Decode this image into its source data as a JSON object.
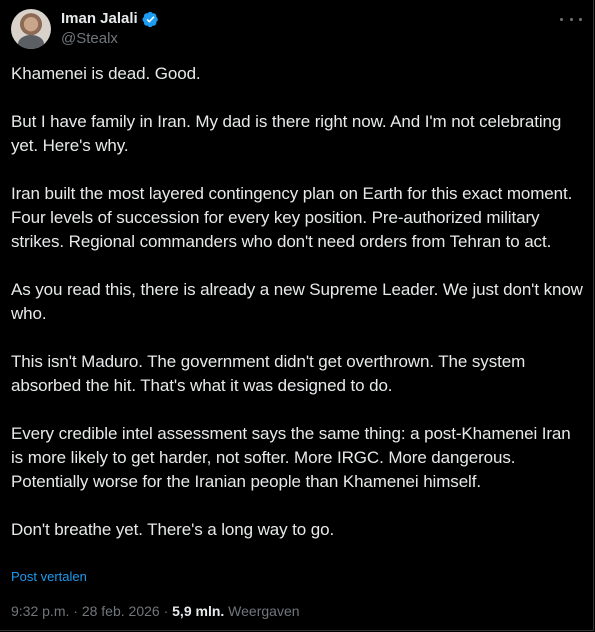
{
  "author": {
    "display_name": "Iman Jalali",
    "handle": "@Stealx",
    "verified": true,
    "verified_color": "#1d9bf0"
  },
  "tweet": {
    "paragraphs": [
      "Khamenei is dead. Good.",
      "But I have family in Iran. My dad is there right now. And I'm not celebrating yet. Here's why.",
      "Iran built the most layered contingency plan on Earth for this exact moment. Four levels of succession for every key position. Pre-authorized military strikes. Regional commanders who don't need orders from Tehran to act.",
      "As you read this, there is already a new Supreme Leader. We just don't know who.",
      "This isn't Maduro. The government didn't get overthrown. The system absorbed the hit. That's what it was designed to do.",
      "Every credible intel assessment says the same thing: a post-Khamenei Iran is more likely to get harder, not softer. More IRGC. More dangerous. Potentially worse for the Iranian people than Khamenei himself.",
      "Don't breathe yet. There's a long way to go."
    ],
    "translate_label": "Post vertalen"
  },
  "meta": {
    "time": "9:32 p.m.",
    "separator": " · ",
    "date": "28 feb. 2026",
    "views_count": "5,9 mln.",
    "views_label": "Weergaven"
  },
  "icons": {
    "more": "more-horizontal-icon",
    "verified": "verified-badge-icon"
  },
  "colors": {
    "background": "#000000",
    "text": "#e7e9ea",
    "muted": "#71767b",
    "accent": "#1d9bf0"
  }
}
